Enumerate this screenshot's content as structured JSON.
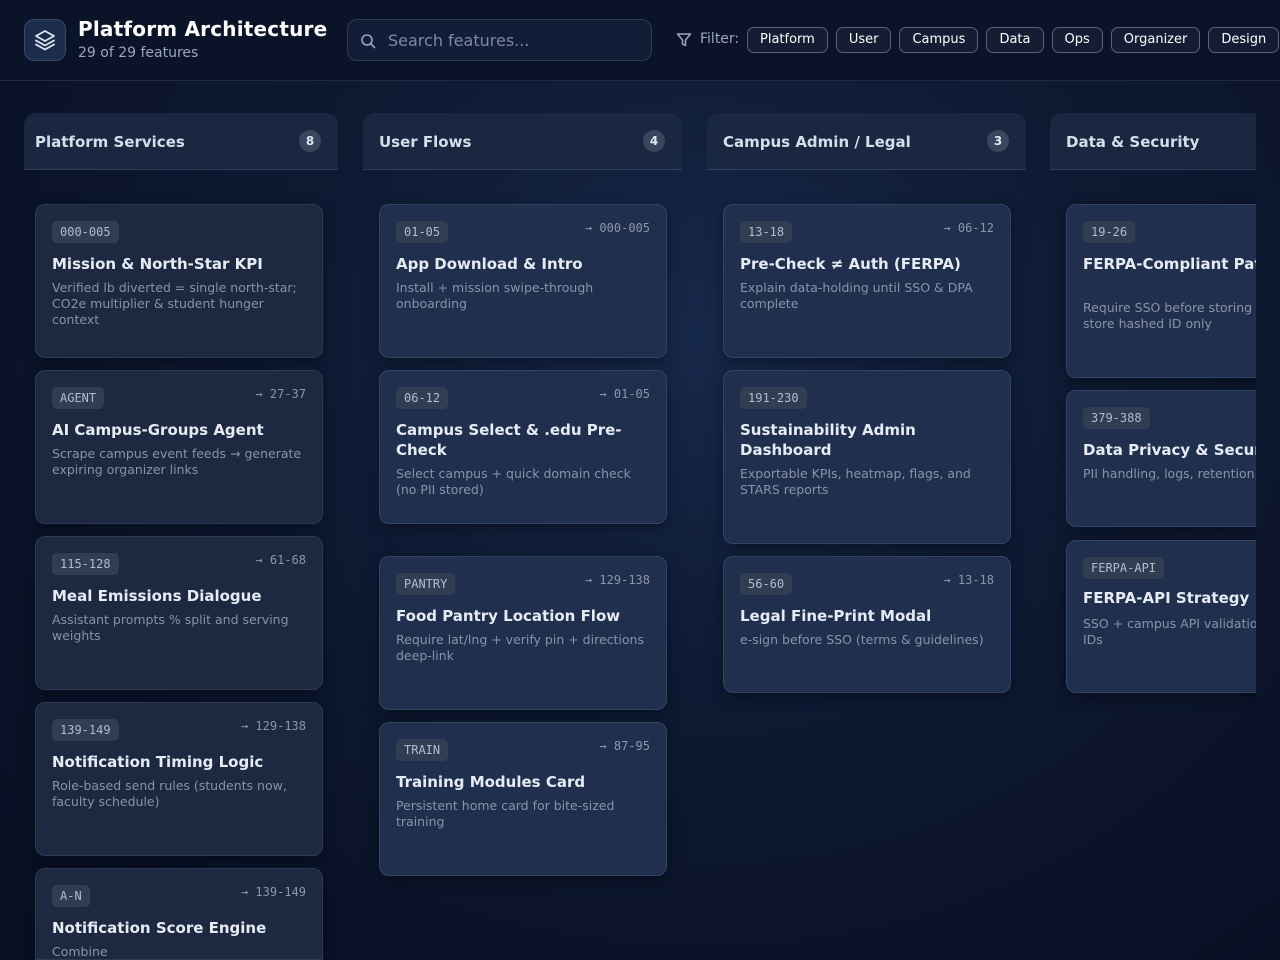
{
  "header": {
    "title": "Platform Architecture",
    "subtitle": "29 of 29 features",
    "search_placeholder": "Search features...",
    "filter_label": "Filter:",
    "filters": [
      "Platform",
      "User",
      "Campus",
      "Data",
      "Ops",
      "Organizer",
      "Design"
    ]
  },
  "columns": [
    {
      "title": "Platform Services",
      "count": "8",
      "cards": [
        {
          "code": "000-005",
          "link": "",
          "title": "Mission & North-Star KPI",
          "desc": "Verified lb diverted = single north-star; CO2e multiplier & student hunger context"
        },
        {
          "code": "AGENT",
          "link": "→ 27-37",
          "title": "AI Campus-Groups Agent",
          "desc": "Scrape campus event feeds → generate expiring organizer links"
        },
        {
          "code": "115-128",
          "link": "→ 61-68",
          "title": "Meal Emissions Dialogue",
          "desc": "Assistant prompts % split and serving weights"
        },
        {
          "code": "139-149",
          "link": "→ 129-138",
          "title": "Notification Timing Logic",
          "desc": "Role-based send rules (students now, faculty schedule)"
        },
        {
          "code": "A-N",
          "link": "→ 139-149",
          "title": "Notification Score Engine",
          "desc": "Combine"
        }
      ]
    },
    {
      "title": "User Flows",
      "count": "4",
      "cards": [
        {
          "code": "01-05",
          "link": "→ 000-005",
          "title": "App Download & Intro",
          "desc": "Install + mission swipe-through onboarding"
        },
        {
          "code": "06-12",
          "link": "→ 01-05",
          "title": "Campus Select & .edu Pre-Check",
          "desc": "Select campus + quick domain check (no PII stored)"
        },
        {
          "code": "PANTRY",
          "link": "→ 129-138",
          "title": "Food Pantry Location Flow",
          "desc": "Require lat/lng + verify pin + directions deep-link"
        },
        {
          "code": "TRAIN",
          "link": "→ 87-95",
          "title": "Training Modules Card",
          "desc": "Persistent home card for bite-sized training"
        }
      ]
    },
    {
      "title": "Campus Admin / Legal",
      "count": "3",
      "cards": [
        {
          "code": "13-18",
          "link": "→ 06-12",
          "title": "Pre-Check ≠ Auth (FERPA)",
          "desc": "Explain data-holding until SSO & DPA complete"
        },
        {
          "code": "191-230",
          "link": "",
          "title": "Sustainability Admin Dashboard",
          "desc": "Exportable KPIs, heatmap, flags, and STARS reports"
        },
        {
          "code": "56-60",
          "link": "→ 13-18",
          "title": "Legal Fine-Print Modal",
          "desc": "e-sign before SSO (terms & guidelines)"
        }
      ]
    },
    {
      "title": "Data & Security",
      "count": "",
      "cards": [
        {
          "code": "19-26",
          "link": "",
          "title": "FERPA-Compliant Path only",
          "desc": "Require SSO before storing data claims; store hashed ID only"
        },
        {
          "code": "379-388",
          "link": "",
          "title": "Data Privacy & Security",
          "desc": "PII handling, logs, retention,"
        },
        {
          "code": "FERPA-API",
          "link": "",
          "title": "FERPA-API Strategy",
          "desc": "SSO + campus API validation; hashed IDs"
        }
      ]
    }
  ]
}
